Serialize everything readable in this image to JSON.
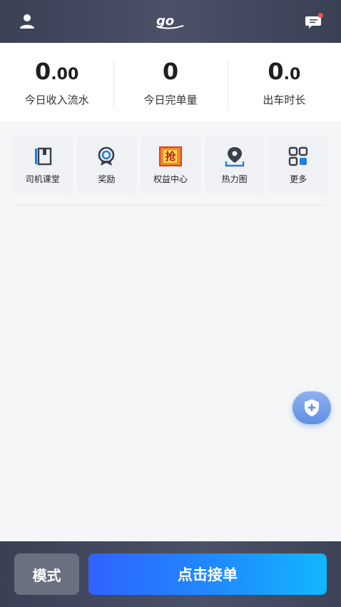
{
  "header": {
    "logo_text": "go",
    "user_icon": "user-icon",
    "message_icon": "message-icon"
  },
  "stats": [
    {
      "value_int": "0",
      "value_dec": ".00",
      "label": "今日收入流水"
    },
    {
      "value_int": "0",
      "value_dec": "",
      "label": "今日完单量"
    },
    {
      "value_int": "0",
      "value_dec": ".0",
      "label": "出车时长"
    }
  ],
  "shortcuts": [
    {
      "label": "司机课堂",
      "icon": "book-icon"
    },
    {
      "label": "奖励",
      "icon": "reward-icon"
    },
    {
      "label": "权益中心",
      "icon": "benefit-icon",
      "icon_text": "抢"
    },
    {
      "label": "热力图",
      "icon": "location-pin-icon"
    },
    {
      "label": "更多",
      "icon": "grid-icon"
    }
  ],
  "bottom": {
    "mode_label": "模式",
    "take_order_label": "点击接单"
  },
  "colors": {
    "header_bg": "#3a4155",
    "accent_blue": "#2f63ff",
    "accent_cyan": "#12b6ff",
    "badge_red": "#ff4d4f"
  }
}
